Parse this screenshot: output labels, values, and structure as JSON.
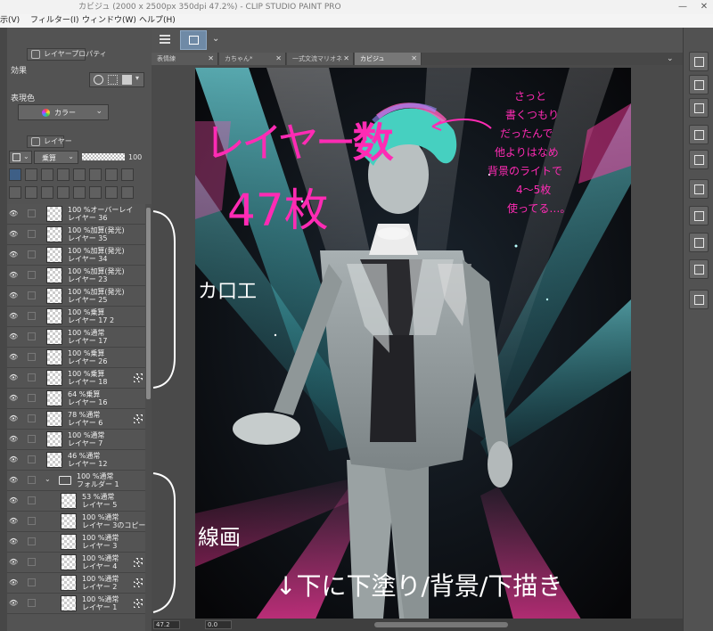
{
  "window": {
    "title": "カビジュ (2000 x 2500px 350dpi 47.2%)  - CLIP STUDIO PAINT PRO",
    "minimize": "—",
    "close": "✕"
  },
  "menu": [
    "示(V)",
    "フィルター(I)",
    "ウィンドウ(W)",
    "ヘルプ(H)"
  ],
  "layer_property": {
    "tab": "レイヤープロパティ",
    "effect_label": "効果",
    "color_label": "表現色",
    "color_value": "カラー"
  },
  "layer_panel": {
    "tab": "レイヤー",
    "blend_mode": "乗算",
    "opacity": "100"
  },
  "layers": [
    {
      "mode": "100 %オーバーレイ",
      "name": "レイヤー 36",
      "marked": false
    },
    {
      "mode": "100 %加算(発光)",
      "name": "レイヤー 35",
      "marked": false
    },
    {
      "mode": "100 %加算(発光)",
      "name": "レイヤー 34",
      "marked": false
    },
    {
      "mode": "100 %加算(発光)",
      "name": "レイヤー 23",
      "marked": false
    },
    {
      "mode": "100 %加算(発光)",
      "name": "レイヤー 25",
      "marked": false
    },
    {
      "mode": "100 %乗算",
      "name": "レイヤー 17 2",
      "marked": false
    },
    {
      "mode": "100 %通常",
      "name": "レイヤー 17",
      "marked": false
    },
    {
      "mode": "100 %乗算",
      "name": "レイヤー 26",
      "marked": false
    },
    {
      "mode": "100 %乗算",
      "name": "レイヤー 18",
      "marked": true
    },
    {
      "mode": "64 %乗算",
      "name": "レイヤー 16",
      "marked": false
    },
    {
      "mode": "78 %通常",
      "name": "レイヤー 6",
      "marked": true
    },
    {
      "mode": "100 %通常",
      "name": "レイヤー 7",
      "marked": false
    },
    {
      "mode": "46 %通常",
      "name": "レイヤー 12",
      "marked": false
    },
    {
      "mode": "100 %通常",
      "name": "フォルダー 1",
      "marked": false,
      "folder": true
    },
    {
      "mode": "53 %通常",
      "name": "レイヤー 5",
      "marked": false,
      "child": true
    },
    {
      "mode": "100 %通常",
      "name": "レイヤー 3のコピー",
      "marked": false,
      "child": true
    },
    {
      "mode": "100 %通常",
      "name": "レイヤー 3",
      "marked": false,
      "child": true
    },
    {
      "mode": "100 %通常",
      "name": "レイヤー 4",
      "marked": true,
      "child": true
    },
    {
      "mode": "100 %通常",
      "name": "レイヤー 2",
      "marked": true,
      "child": true
    },
    {
      "mode": "100 %通常",
      "name": "レイヤー 1",
      "marked": true,
      "child": true
    }
  ],
  "tabs": [
    {
      "label": "表情練",
      "active": false
    },
    {
      "label": "カちゃん*",
      "active": false
    },
    {
      "label": "一式文流マリオネ",
      "active": false
    },
    {
      "label": "カビジュ",
      "active": true
    }
  ],
  "status": {
    "zoom": "47.2",
    "angle": "0.0"
  },
  "annotations": {
    "headline_a": "レイヤー",
    "headline_b": "数",
    "count": "47枚",
    "note_lines": [
      "さっと",
      "書くつもり",
      "だったんで",
      "他よりはなめ",
      "背景のライトで",
      "4〜5枚",
      "使ってる…。"
    ],
    "group_paint": "カ口工",
    "group_line": "線画",
    "footer": "↓下に下塗り/背景/下描き"
  },
  "colors": {
    "annotation_pink": "#ff2bb4",
    "annotation_white": "#ffffff"
  }
}
